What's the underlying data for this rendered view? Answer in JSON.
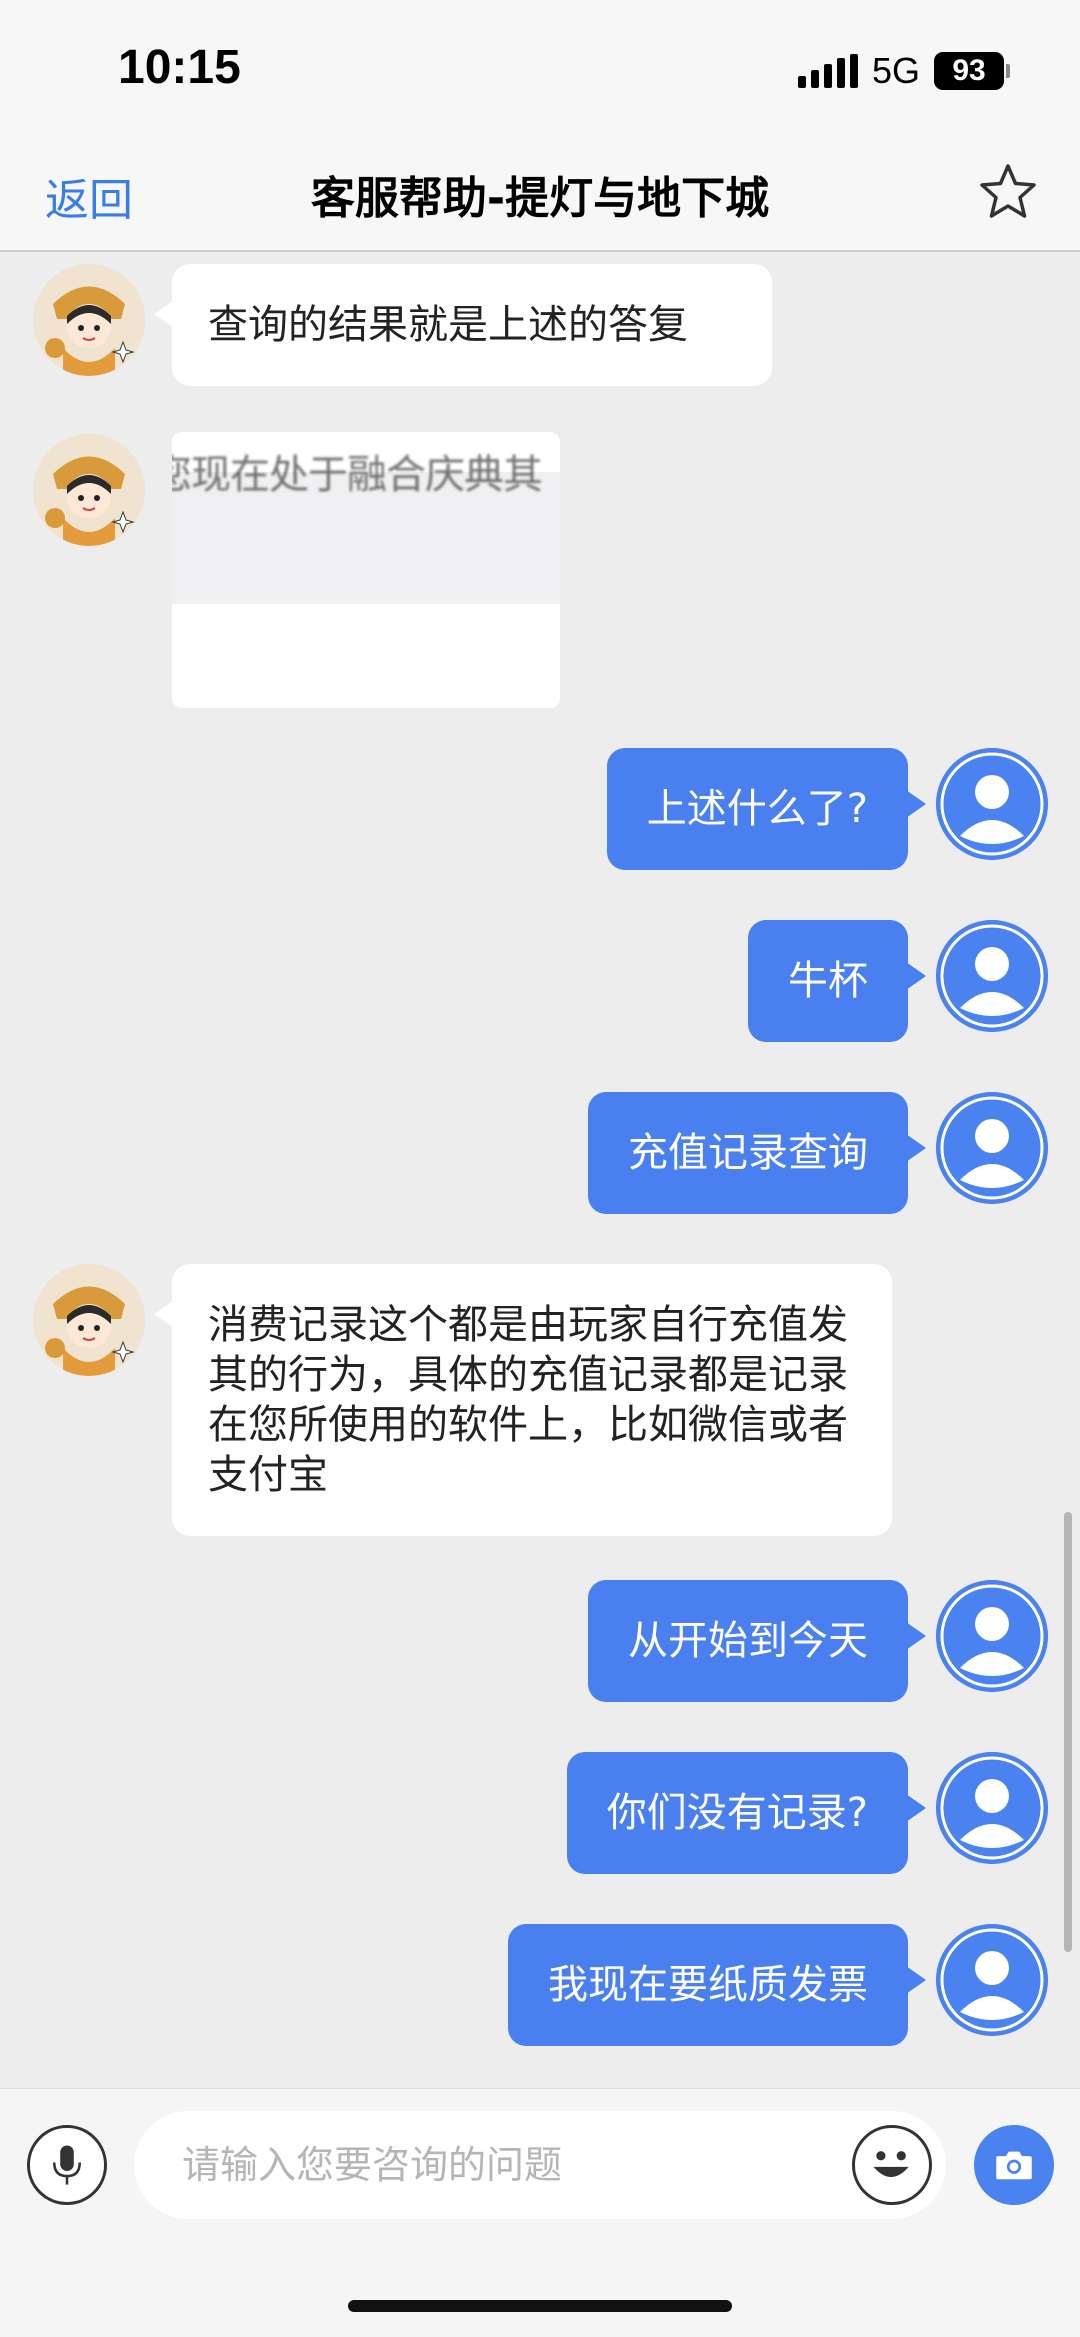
{
  "status_bar": {
    "time": "10:15",
    "network": "5G",
    "battery": "93"
  },
  "nav": {
    "back_label": "返回",
    "title": "客服帮助-提灯与地下城",
    "star_icon": "star-outline-icon"
  },
  "colors": {
    "accent": "#3a7de8",
    "user_bubble": "#4a7ff0",
    "background": "#ededed"
  },
  "messages": [
    {
      "sender": "agent",
      "text": "查询的结果就是上述的答复"
    },
    {
      "sender": "agent",
      "text": "您现在处于融合庆典其"
    },
    {
      "sender": "user",
      "text": "上述什么了?"
    },
    {
      "sender": "user",
      "text": "牛杯"
    },
    {
      "sender": "user",
      "text": "充值记录查询"
    },
    {
      "sender": "agent",
      "text": "消费记录这个都是由玩家自行充值发其的行为，具体的充值记录都是记录在您所使用的软件上，比如微信或者支付宝"
    },
    {
      "sender": "user",
      "text": "从开始到今天"
    },
    {
      "sender": "user",
      "text": "你们没有记录?"
    },
    {
      "sender": "user",
      "text": "我现在要纸质发票"
    }
  ],
  "input": {
    "placeholder": "请输入您要咨询的问题",
    "value": ""
  }
}
